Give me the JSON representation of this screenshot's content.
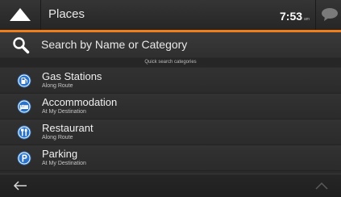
{
  "header": {
    "title": "Places",
    "time": "7:53",
    "ampm": "am",
    "menu_icon": "triangle-up-icon",
    "chat_icon": "speech-bubble-icon"
  },
  "accent_color": "#f07f19",
  "search": {
    "label": "Search by Name or Category",
    "icon": "magnifier-icon"
  },
  "quick_search": {
    "header": "Quick search categories",
    "items": [
      {
        "title": "Gas Stations",
        "subtitle": "Along Route",
        "icon": "fuel-pump-icon"
      },
      {
        "title": "Accommodation",
        "subtitle": "At My Destination",
        "icon": "bed-icon"
      },
      {
        "title": "Restaurant",
        "subtitle": "Along Route",
        "icon": "fork-knife-icon"
      },
      {
        "title": "Parking",
        "subtitle": "At My Destination",
        "icon": "parking-icon"
      }
    ]
  },
  "footer": {
    "back_icon": "back-arrow-icon",
    "up_icon": "chevron-up-icon"
  }
}
